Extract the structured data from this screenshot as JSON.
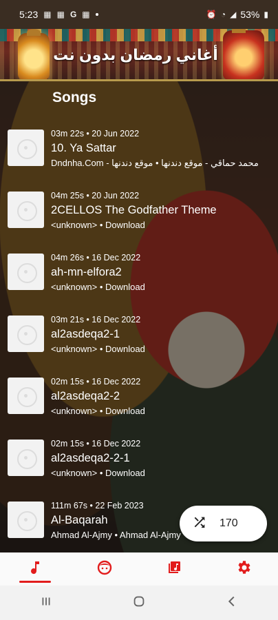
{
  "status": {
    "time": "5:23",
    "battery": "53%"
  },
  "banner": {
    "title": "أغاني رمضان بدون نت"
  },
  "section": {
    "title": "Songs"
  },
  "songs": [
    {
      "meta": "03m 22s • 20 Jun 2022",
      "title": "10. Ya Sattar",
      "sub": "محمد حماقي - موقع دندنها • موقع دندنها - Dndnha.Com"
    },
    {
      "meta": "04m 25s • 20 Jun 2022",
      "title": "2CELLOS  The Godfather Theme",
      "sub": "<unknown> • Download"
    },
    {
      "meta": "04m 26s • 16 Dec 2022",
      "title": "ah-mn-elfora2",
      "sub": "<unknown> • Download"
    },
    {
      "meta": "03m 21s • 16 Dec 2022",
      "title": "al2asdeqa2-1",
      "sub": "<unknown> • Download"
    },
    {
      "meta": "02m 15s • 16 Dec 2022",
      "title": "al2asdeqa2-2",
      "sub": "<unknown> • Download"
    },
    {
      "meta": "02m 15s • 16 Dec 2022",
      "title": "al2asdeqa2-2-1",
      "sub": "<unknown> • Download"
    },
    {
      "meta": "111m 67s • 22 Feb 2023",
      "title": "Al-Baqarah",
      "sub": "Ahmad Al-Ajmy • Ahmad Al-Ajmy"
    }
  ],
  "shuffle": {
    "count": "170"
  },
  "colors": {
    "accent": "#e21c1c"
  },
  "nav": {
    "items": [
      "music-note-icon",
      "face-icon",
      "album-icon",
      "settings-gear-icon"
    ],
    "active": 0
  }
}
